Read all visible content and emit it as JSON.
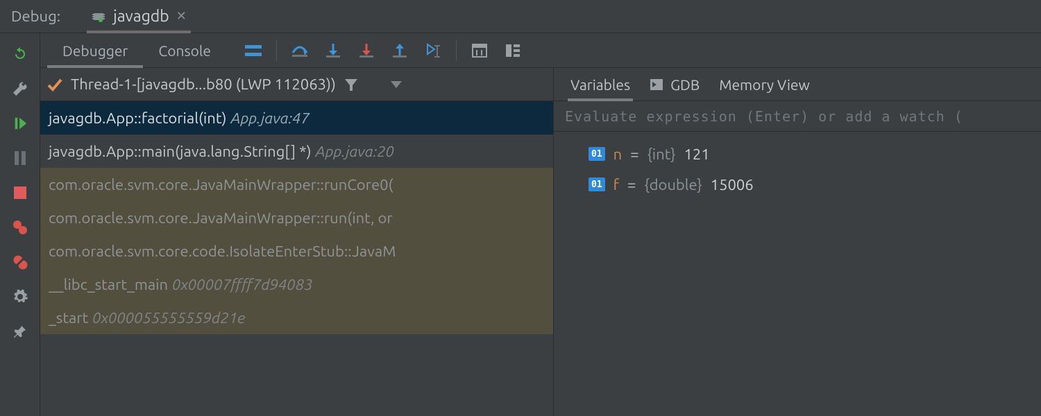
{
  "header": {
    "label": "Debug:",
    "config_name": "javagdb"
  },
  "tabs": {
    "debugger": "Debugger",
    "console": "Console"
  },
  "thread": {
    "name": "Thread-1-[javagdb...b80 (LWP 112063))"
  },
  "frames": [
    {
      "sig": "javagdb.App::factorial(int)",
      "loc": "App.java:47",
      "kind": "selected"
    },
    {
      "sig": "javagdb.App::main(java.lang.String[] *)",
      "loc": "App.java:20",
      "kind": "user"
    },
    {
      "sig": "com.oracle.svm.core.JavaMainWrapper::runCore0(",
      "loc": "",
      "kind": "external"
    },
    {
      "sig": "com.oracle.svm.core.JavaMainWrapper::run(int, or",
      "loc": "",
      "kind": "external"
    },
    {
      "sig": "com.oracle.svm.core.code.IsolateEnterStub::JavaM",
      "loc": "",
      "kind": "external"
    },
    {
      "sig": "__libc_start_main",
      "loc": "0x00007ffff7d94083",
      "kind": "external"
    },
    {
      "sig": "_start",
      "loc": "0x000055555559d21e",
      "kind": "external"
    }
  ],
  "right_tabs": {
    "variables": "Variables",
    "gdb": "GDB",
    "memory": "Memory View"
  },
  "watch_placeholder": "Evaluate expression (Enter) or add a watch (",
  "variables": [
    {
      "name": "n",
      "type": "{int}",
      "value": "121"
    },
    {
      "name": "f",
      "type": "{double}",
      "value": "15006"
    }
  ]
}
